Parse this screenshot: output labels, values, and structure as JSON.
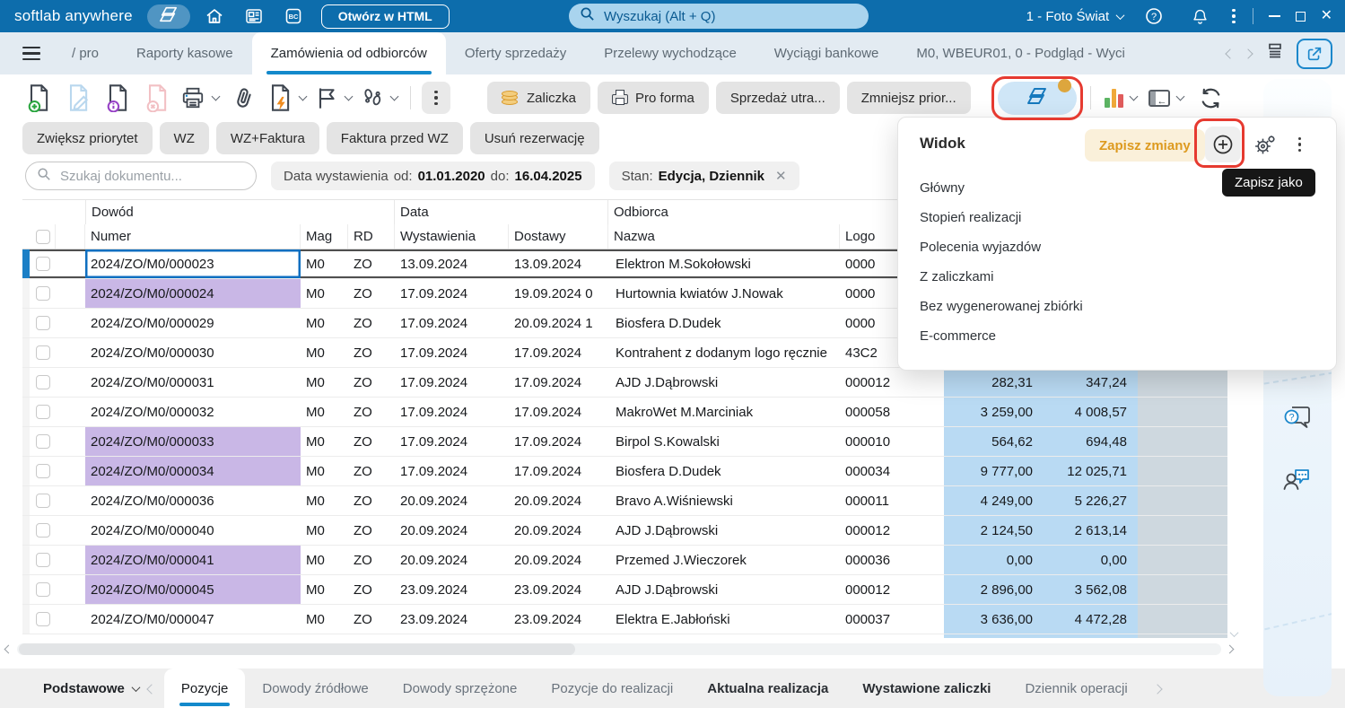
{
  "topbar": {
    "app_name": "softlab anywhere",
    "open_html_label": "Otwórz w HTML",
    "search_placeholder": "Wyszukaj (Alt + Q)",
    "company": "1 - Foto Świat",
    "icons": [
      "views-icon",
      "home-icon",
      "news-icon",
      "bc-icon",
      "search-icon",
      "help-icon",
      "bell-icon",
      "more-options-icon",
      "minimize-icon",
      "maximize-icon",
      "close-icon"
    ]
  },
  "tabs": {
    "items": [
      {
        "label": "/ pro"
      },
      {
        "label": "Raporty kasowe"
      },
      {
        "label": "Zamówienia od odbiorców",
        "active": true
      },
      {
        "label": "Oferty sprzedaży"
      },
      {
        "label": "Przelewy wychodzące"
      },
      {
        "label": "Wyciągi bankowe"
      },
      {
        "label": "M0, WBEUR01, 0 - Podgląd - Wyci"
      }
    ],
    "icons": [
      "chevron-left-icon",
      "chevron-right-icon",
      "tab-list-icon",
      "share-icon"
    ]
  },
  "toolbar": {
    "icon_names": [
      "new-document-icon",
      "edit-document-icon",
      "document-info-icon",
      "delete-document-icon",
      "print-icon",
      "attachment-icon",
      "document-flash-icon",
      "flag-icon",
      "footsteps-icon",
      "more-options-icon",
      "views-icon",
      "chart-icon",
      "dock-panel-icon",
      "refresh-icon"
    ],
    "buttons_row1": [
      {
        "label": "Zaliczka",
        "icon": "coins-icon"
      },
      {
        "label": "Pro forma",
        "icon": "printer-small-icon"
      },
      {
        "label": "Sprzedaż utra..."
      },
      {
        "label": "Zmniejsz prior..."
      }
    ],
    "buttons_row2": [
      {
        "label": "Zwiększ priorytet"
      },
      {
        "label": "WZ"
      },
      {
        "label": "WZ+Faktura"
      },
      {
        "label": "Faktura przed WZ"
      },
      {
        "label": "Usuń rezerwację"
      }
    ]
  },
  "filters": {
    "doc_search_placeholder": "Szukaj dokumentu...",
    "date_chip": {
      "label": "Data wystawienia",
      "from_label": "od:",
      "from": "01.01.2020",
      "to_label": "do:",
      "to": "16.04.2025"
    },
    "state_chip": {
      "label": "Stan:",
      "value": "Edycja, Dziennik"
    }
  },
  "table": {
    "group_headers": {
      "dowod": "Dowód",
      "data": "Data",
      "odbiorca": "Odbiorca"
    },
    "columns": {
      "numer": "Numer",
      "mag": "Mag",
      "rd": "RD",
      "wystawienia": "Wystawienia",
      "dostawy": "Dostawy",
      "nazwa": "Nazwa",
      "logo": "Logo"
    },
    "rows": [
      {
        "numer": "2024/ZO/M0/000023",
        "mag": "M0",
        "rd": "ZO",
        "wystawienia": "13.09.2024",
        "dostawy": "13.09.2024",
        "nazwa": "Elektron M.Sokołowski",
        "logo": "0000",
        "netto": "",
        "brutto": "",
        "selected": true
      },
      {
        "numer": "2024/ZO/M0/000024",
        "mag": "M0",
        "rd": "ZO",
        "wystawienia": "17.09.2024",
        "dostawy": "19.09.2024 0",
        "nazwa": "Hurtownia kwiatów J.Nowak",
        "logo": "0000",
        "netto": "",
        "brutto": "",
        "highlighted": true
      },
      {
        "numer": "2024/ZO/M0/000029",
        "mag": "M0",
        "rd": "ZO",
        "wystawienia": "17.09.2024",
        "dostawy": "20.09.2024 1",
        "nazwa": "Biosfera D.Dudek",
        "logo": "0000",
        "netto": "",
        "brutto": ""
      },
      {
        "numer": "2024/ZO/M0/000030",
        "mag": "M0",
        "rd": "ZO",
        "wystawienia": "17.09.2024",
        "dostawy": "17.09.2024",
        "nazwa": "Kontrahent z dodanym logo ręcznie",
        "logo": "43C2",
        "netto": "",
        "brutto": ""
      },
      {
        "numer": "2024/ZO/M0/000031",
        "mag": "M0",
        "rd": "ZO",
        "wystawienia": "17.09.2024",
        "dostawy": "17.09.2024",
        "nazwa": "AJD J.Dąbrowski",
        "logo": "000012",
        "netto": "282,31",
        "brutto": "347,24"
      },
      {
        "numer": "2024/ZO/M0/000032",
        "mag": "M0",
        "rd": "ZO",
        "wystawienia": "17.09.2024",
        "dostawy": "17.09.2024",
        "nazwa": "MakroWet M.Marciniak",
        "logo": "000058",
        "netto": "3 259,00",
        "brutto": "4 008,57"
      },
      {
        "numer": "2024/ZO/M0/000033",
        "mag": "M0",
        "rd": "ZO",
        "wystawienia": "17.09.2024",
        "dostawy": "17.09.2024",
        "nazwa": "Birpol S.Kowalski",
        "logo": "000010",
        "netto": "564,62",
        "brutto": "694,48",
        "highlighted": true
      },
      {
        "numer": "2024/ZO/M0/000034",
        "mag": "M0",
        "rd": "ZO",
        "wystawienia": "17.09.2024",
        "dostawy": "17.09.2024",
        "nazwa": "Biosfera D.Dudek",
        "logo": "000034",
        "netto": "9 777,00",
        "brutto": "12 025,71",
        "highlighted": true
      },
      {
        "numer": "2024/ZO/M0/000036",
        "mag": "M0",
        "rd": "ZO",
        "wystawienia": "20.09.2024",
        "dostawy": "20.09.2024",
        "nazwa": "Bravo A.Wiśniewski",
        "logo": "000011",
        "netto": "4 249,00",
        "brutto": "5 226,27"
      },
      {
        "numer": "2024/ZO/M0/000040",
        "mag": "M0",
        "rd": "ZO",
        "wystawienia": "20.09.2024",
        "dostawy": "20.09.2024",
        "nazwa": "AJD J.Dąbrowski",
        "logo": "000012",
        "netto": "2 124,50",
        "brutto": "2 613,14"
      },
      {
        "numer": "2024/ZO/M0/000041",
        "mag": "M0",
        "rd": "ZO",
        "wystawienia": "20.09.2024",
        "dostawy": "20.09.2024",
        "nazwa": "Przemed J.Wieczorek",
        "logo": "000036",
        "netto": "0,00",
        "brutto": "0,00",
        "highlighted": true
      },
      {
        "numer": "2024/ZO/M0/000045",
        "mag": "M0",
        "rd": "ZO",
        "wystawienia": "23.09.2024",
        "dostawy": "23.09.2024",
        "nazwa": "AJD J.Dąbrowski",
        "logo": "000012",
        "netto": "2 896,00",
        "brutto": "3 562,08",
        "highlighted": true
      },
      {
        "numer": "2024/ZO/M0/000047",
        "mag": "M0",
        "rd": "ZO",
        "wystawienia": "23.09.2024",
        "dostawy": "23.09.2024",
        "nazwa": "Elektra E.Jabłoński",
        "logo": "000037",
        "netto": "3 636,00",
        "brutto": "4 472,28"
      }
    ]
  },
  "view_panel": {
    "title": "Widok",
    "save_button": "Zapisz zmiany",
    "tooltip": "Zapisz jako",
    "icons": [
      "add-view-icon",
      "settings-gear-icon",
      "more-options-icon"
    ],
    "items": [
      "Główny",
      "Stopień realizacji",
      "Polecenia wyjazdów",
      "Z zaliczkami",
      "Bez wygenerowanej zbiórki",
      "E-commerce"
    ]
  },
  "sidebar": {
    "icons": [
      "help-bubble-icon",
      "community-chat-icon"
    ]
  },
  "bottom": {
    "primary": "Podstawowe",
    "tabs": [
      {
        "label": "Pozycje",
        "active": true
      },
      {
        "label": "Dowody źródłowe"
      },
      {
        "label": "Dowody sprzężone"
      },
      {
        "label": "Pozycje do realizacji"
      },
      {
        "label": "Aktualna realizacja",
        "bold": true
      },
      {
        "label": "Wystawione zaliczki",
        "bold": true
      },
      {
        "label": "Dziennik operacji"
      }
    ]
  },
  "colors": {
    "topbar": "#0d6dac",
    "accent": "#1389cb",
    "row_highlight": "#c9b7e6",
    "amount_cell": "#b9daf3",
    "annotation_red": "#e63a30",
    "save_accent": "#dd9a1f"
  }
}
